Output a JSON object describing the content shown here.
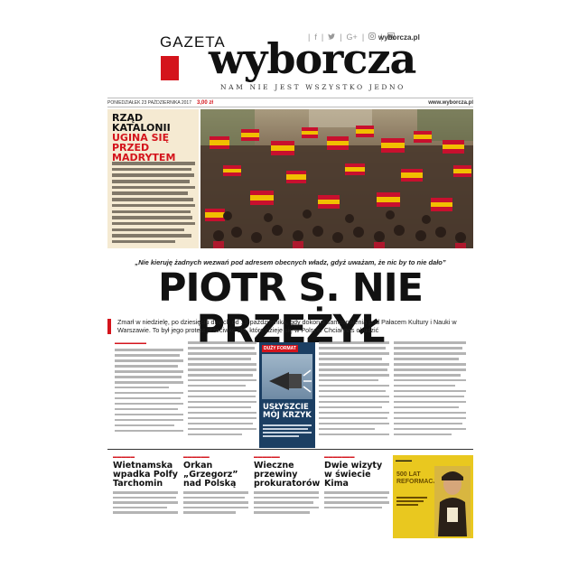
{
  "masthead": {
    "gazeta": "GAZETA",
    "wyborcza": "wyborcza",
    "motto": "NAM NIE JEST WSZYSTKO JEDNO",
    "website": "wyborcza.pl",
    "social_icons": [
      "facebook-icon",
      "twitter-icon",
      "google-plus-icon",
      "instagram-icon",
      "wyborcza-icon"
    ]
  },
  "dateline": {
    "date": "PONIEDZIAŁEK 23 PAŹDZIERNIKA 2017",
    "price": "3,00 zł",
    "web": "www.wyborcza.pl"
  },
  "catalonia": {
    "title_line1": "RZĄD KATALONII",
    "title_line2": "UGINA SIĘ PRZED",
    "title_line3": "MADRYTEM"
  },
  "main": {
    "quote": "„Nie kieruję żadnych wezwań pod adresem obecnych władz, gdyż uważam, że nic by to nie dało”",
    "headline": "PIOTR S. NIE PRZEŻYŁ",
    "lead": "Zmarł w niedzielę, po dziesięciu dniach od 19 października, gdy dokonał samospalenia pod Pałacem Kultury i Nauki w Warszawie. To był jego protest przeciwko złu, które dzieje się w Polsce. Chciał nas obudzić"
  },
  "promo": {
    "tag": "DUŻY FORMAT",
    "title": "USŁYSZCIE MÓJ KRZYK"
  },
  "teasers": [
    {
      "title": "Wietnamska wpadka Polfy Tarchomin"
    },
    {
      "title": "Orkan „Grzegorz” nad Polską"
    },
    {
      "title": "Wieczne przewiny prokuratorów"
    },
    {
      "title": "Dwie wizyty w świecie Kima"
    }
  ],
  "ad": {
    "title": "500 LAT REFORMACJI"
  },
  "colors": {
    "brand_red": "#d4141c",
    "ad_yellow": "#e9c81f",
    "catalonia_box": "#f5ead2",
    "promo_blue": "#1c3f63"
  }
}
